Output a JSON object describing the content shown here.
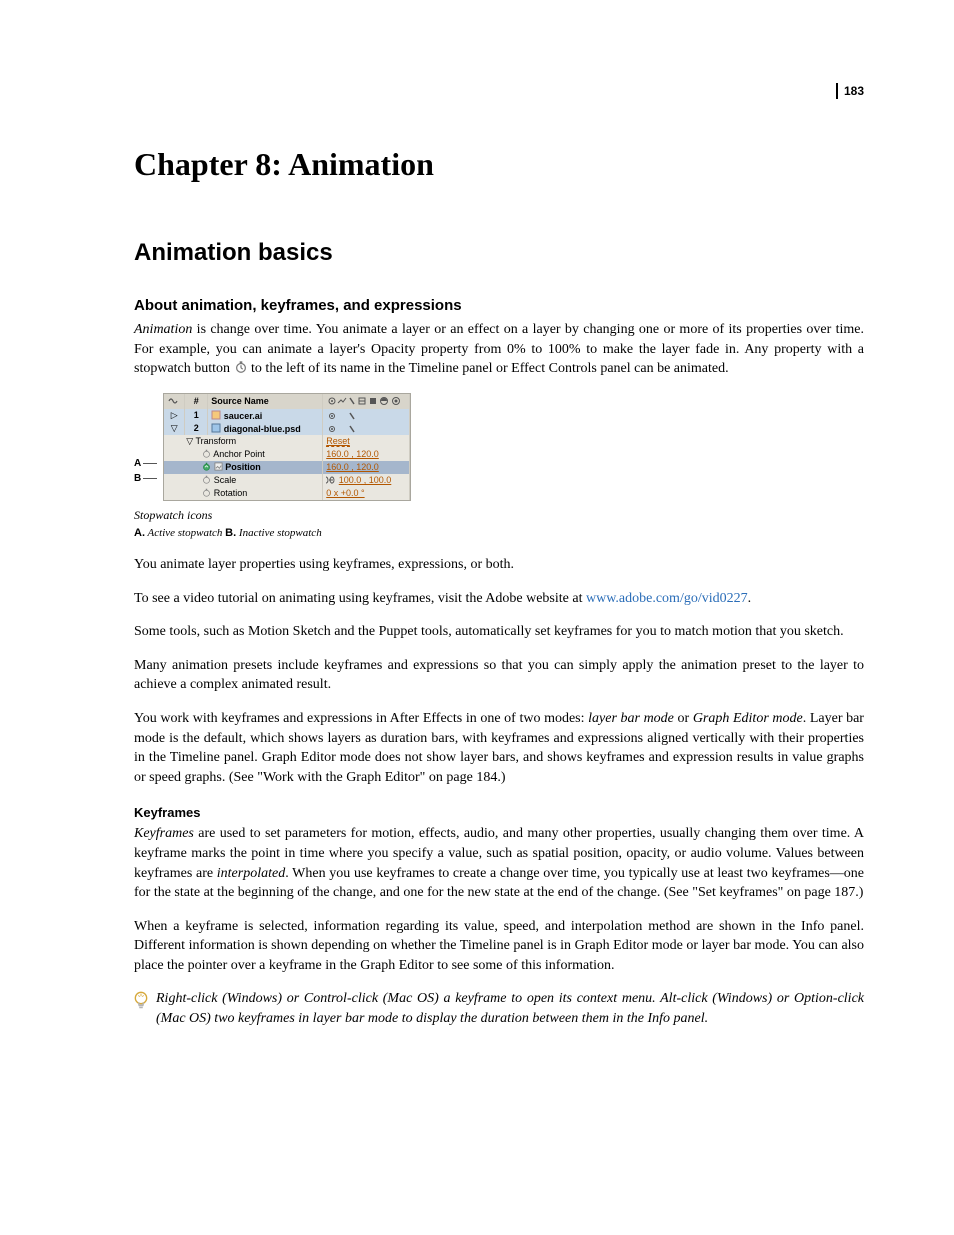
{
  "pageNumber": "183",
  "chapterTitle": "Chapter 8: Animation",
  "sectionTitle": "Animation basics",
  "sub1Title": "About animation, keyframes, and expressions",
  "p1a": "Animation",
  "p1b": " is change over time. You animate a layer or an effect on a layer by changing one or more of its properties over time. For example, you can animate a layer's Opacity property from 0% to 100% to make the layer fade in. Any property with a stopwatch button ",
  "p1c": " to the left of its name in the Timeline panel or Effect Controls panel can be animated.",
  "figure": {
    "labelA": "A",
    "labelB": "B",
    "headerNum": "#",
    "headerSource": "Source Name",
    "layer1Num": "1",
    "layer1Name": "saucer.ai",
    "layer2Num": "2",
    "layer2Name": "diagonal-blue.psd",
    "transform": "Transform",
    "reset": "Reset",
    "propAnchor": "Anchor Point",
    "valAnchor": "160.0 , 120.0",
    "propPosition": "Position",
    "valPosition": "160.0 , 120.0",
    "propScale": "Scale",
    "valScale": "100.0 , 100.0",
    "propRotation": "Rotation",
    "valRotation": "0 x +0.0 °"
  },
  "captionTitle": "Stopwatch icons",
  "captionA": "A.",
  "captionAText": " Active stopwatch  ",
  "captionB": "B.",
  "captionBText": " Inactive stopwatch",
  "p2": "You animate layer properties using keyframes, expressions, or both.",
  "p3a": "To see a video tutorial on animating using keyframes, visit the Adobe website at ",
  "p3link": "www.adobe.com/go/vid0227",
  "p3b": ".",
  "p4": "Some tools, such as Motion Sketch and the Puppet tools, automatically set keyframes for you to match motion that you sketch.",
  "p5": "Many animation presets include keyframes and expressions so that you can simply apply the animation preset to the layer to achieve a complex animated result.",
  "p6a": "You work with keyframes and expressions in After Effects in one of two modes: ",
  "p6i1": "layer bar mode",
  "p6b": " or ",
  "p6i2": "Graph Editor mode",
  "p6c": ". Layer bar mode is the default, which shows layers as duration bars, with keyframes and expressions aligned vertically with their properties in the Timeline panel. Graph Editor mode does not show layer bars, and shows keyframes and expression results in value graphs or speed graphs. (See \"Work with the Graph Editor\" on page 184.)",
  "sub2Title": "Keyframes",
  "p7a": "Keyframes",
  "p7b": " are used to set parameters for motion, effects, audio, and many other properties, usually changing them over time. A keyframe marks the point in time where you specify a value, such as spatial position, opacity, or audio volume. Values between keyframes are ",
  "p7c": "interpolated",
  "p7d": ". When you use keyframes to create a change over time, you typically use at least two keyframes—one for the state at the beginning of the change, and one for the new state at the end of the change. (See \"Set keyframes\" on page 187.)",
  "p8": "When a keyframe is selected, information regarding its value, speed, and interpolation method are shown in the Info panel. Different information is shown depending on whether the Timeline panel is in Graph Editor mode or layer bar mode. You can also place the pointer over a keyframe in the Graph Editor to see some of this information.",
  "tip": "Right-click (Windows) or Control-click (Mac OS) a keyframe to open its context menu. Alt-click (Windows) or Option-click (Mac OS) two keyframes in layer bar mode to display the duration between them in the Info panel."
}
